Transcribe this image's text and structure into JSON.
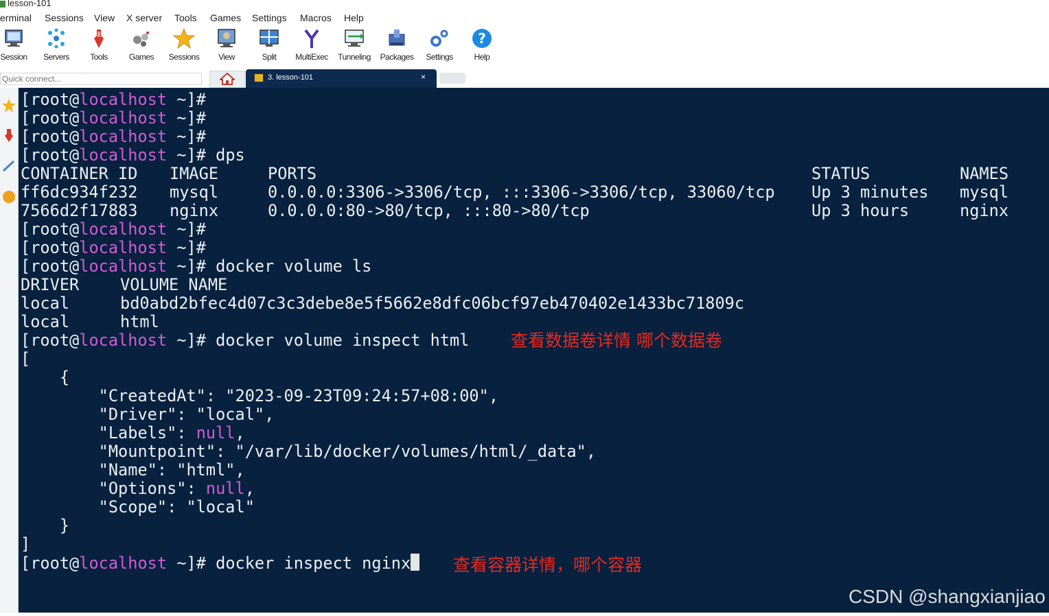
{
  "window": {
    "title": "lesson-101"
  },
  "menu": [
    "erminal",
    "Sessions",
    "View",
    "X server",
    "Tools",
    "Games",
    "Settings",
    "Macros",
    "Help"
  ],
  "toolbar": [
    {
      "label": "Session",
      "icon": "session-icon"
    },
    {
      "label": "Servers",
      "icon": "servers-icon"
    },
    {
      "label": "Tools",
      "icon": "tools-icon"
    },
    {
      "label": "Games",
      "icon": "games-icon"
    },
    {
      "label": "Sessions",
      "icon": "star-icon"
    },
    {
      "label": "View",
      "icon": "view-icon"
    },
    {
      "label": "Split",
      "icon": "split-icon"
    },
    {
      "label": "MultiExec",
      "icon": "multiexec-icon"
    },
    {
      "label": "Tunneling",
      "icon": "tunneling-icon"
    },
    {
      "label": "Packages",
      "icon": "packages-icon"
    },
    {
      "label": "Settings",
      "icon": "settings-icon"
    },
    {
      "label": "Help",
      "icon": "help-icon"
    }
  ],
  "quick_connect": {
    "placeholder": "Quick connect..."
  },
  "tabs": {
    "session_label": "3. lesson-101",
    "close": "×"
  },
  "terminal": {
    "prompt_open": "[root@",
    "prompt_host": "localhost",
    "prompt_close": " ~]#",
    "commands": {
      "dps": " dps",
      "volume_ls": " docker volume ls",
      "volume_inspect": " docker volume inspect html",
      "inspect_nginx": " docker inspect nginx"
    },
    "ps_table": {
      "headers": [
        "CONTAINER ID",
        "IMAGE",
        "PORTS",
        "STATUS",
        "NAMES"
      ],
      "rows": [
        [
          "ff6dc934f232",
          "mysql",
          "0.0.0.0:3306->3306/tcp, :::3306->3306/tcp, 33060/tcp",
          "Up 3 minutes",
          "mysql"
        ],
        [
          "7566d2f17883",
          "nginx",
          "0.0.0.0:80->80/tcp, :::80->80/tcp",
          "Up 3 hours",
          "nginx"
        ]
      ]
    },
    "volume_table": {
      "headers": [
        "DRIVER",
        "VOLUME NAME"
      ],
      "rows": [
        [
          "local",
          "bd0abd2bfec4d07c3c3debe8e5f5662e8dfc06bcf97eb470402e1433bc71809c"
        ],
        [
          "local",
          "html"
        ]
      ]
    },
    "json_output": {
      "open_bracket": "[",
      "open_brace": "    {",
      "created_at": "        \"CreatedAt\": \"2023-09-23T09:24:57+08:00\",",
      "driver": "        \"Driver\": \"local\",",
      "labels_key": "        \"Labels\": ",
      "labels_val": "null",
      "comma": ",",
      "mountpoint": "        \"Mountpoint\": \"/var/lib/docker/volumes/html/_data\",",
      "name": "        \"Name\": \"html\",",
      "options_key": "        \"Options\": ",
      "options_val": "null",
      "scope": "        \"Scope\": \"local\"",
      "close_brace": "    }",
      "close_bracket": "]"
    }
  },
  "annotations": {
    "volume_note": "查看数据卷详情 哪个数据卷",
    "container_note": "查看容器详情，哪个容器"
  },
  "watermark": "CSDN @shangxianjiao",
  "colors": {
    "terminal_bg": "#07213f",
    "terminal_fg": "#ecf0f4",
    "host_magenta": "#d35bd3",
    "annotation_red": "#e8281e"
  }
}
